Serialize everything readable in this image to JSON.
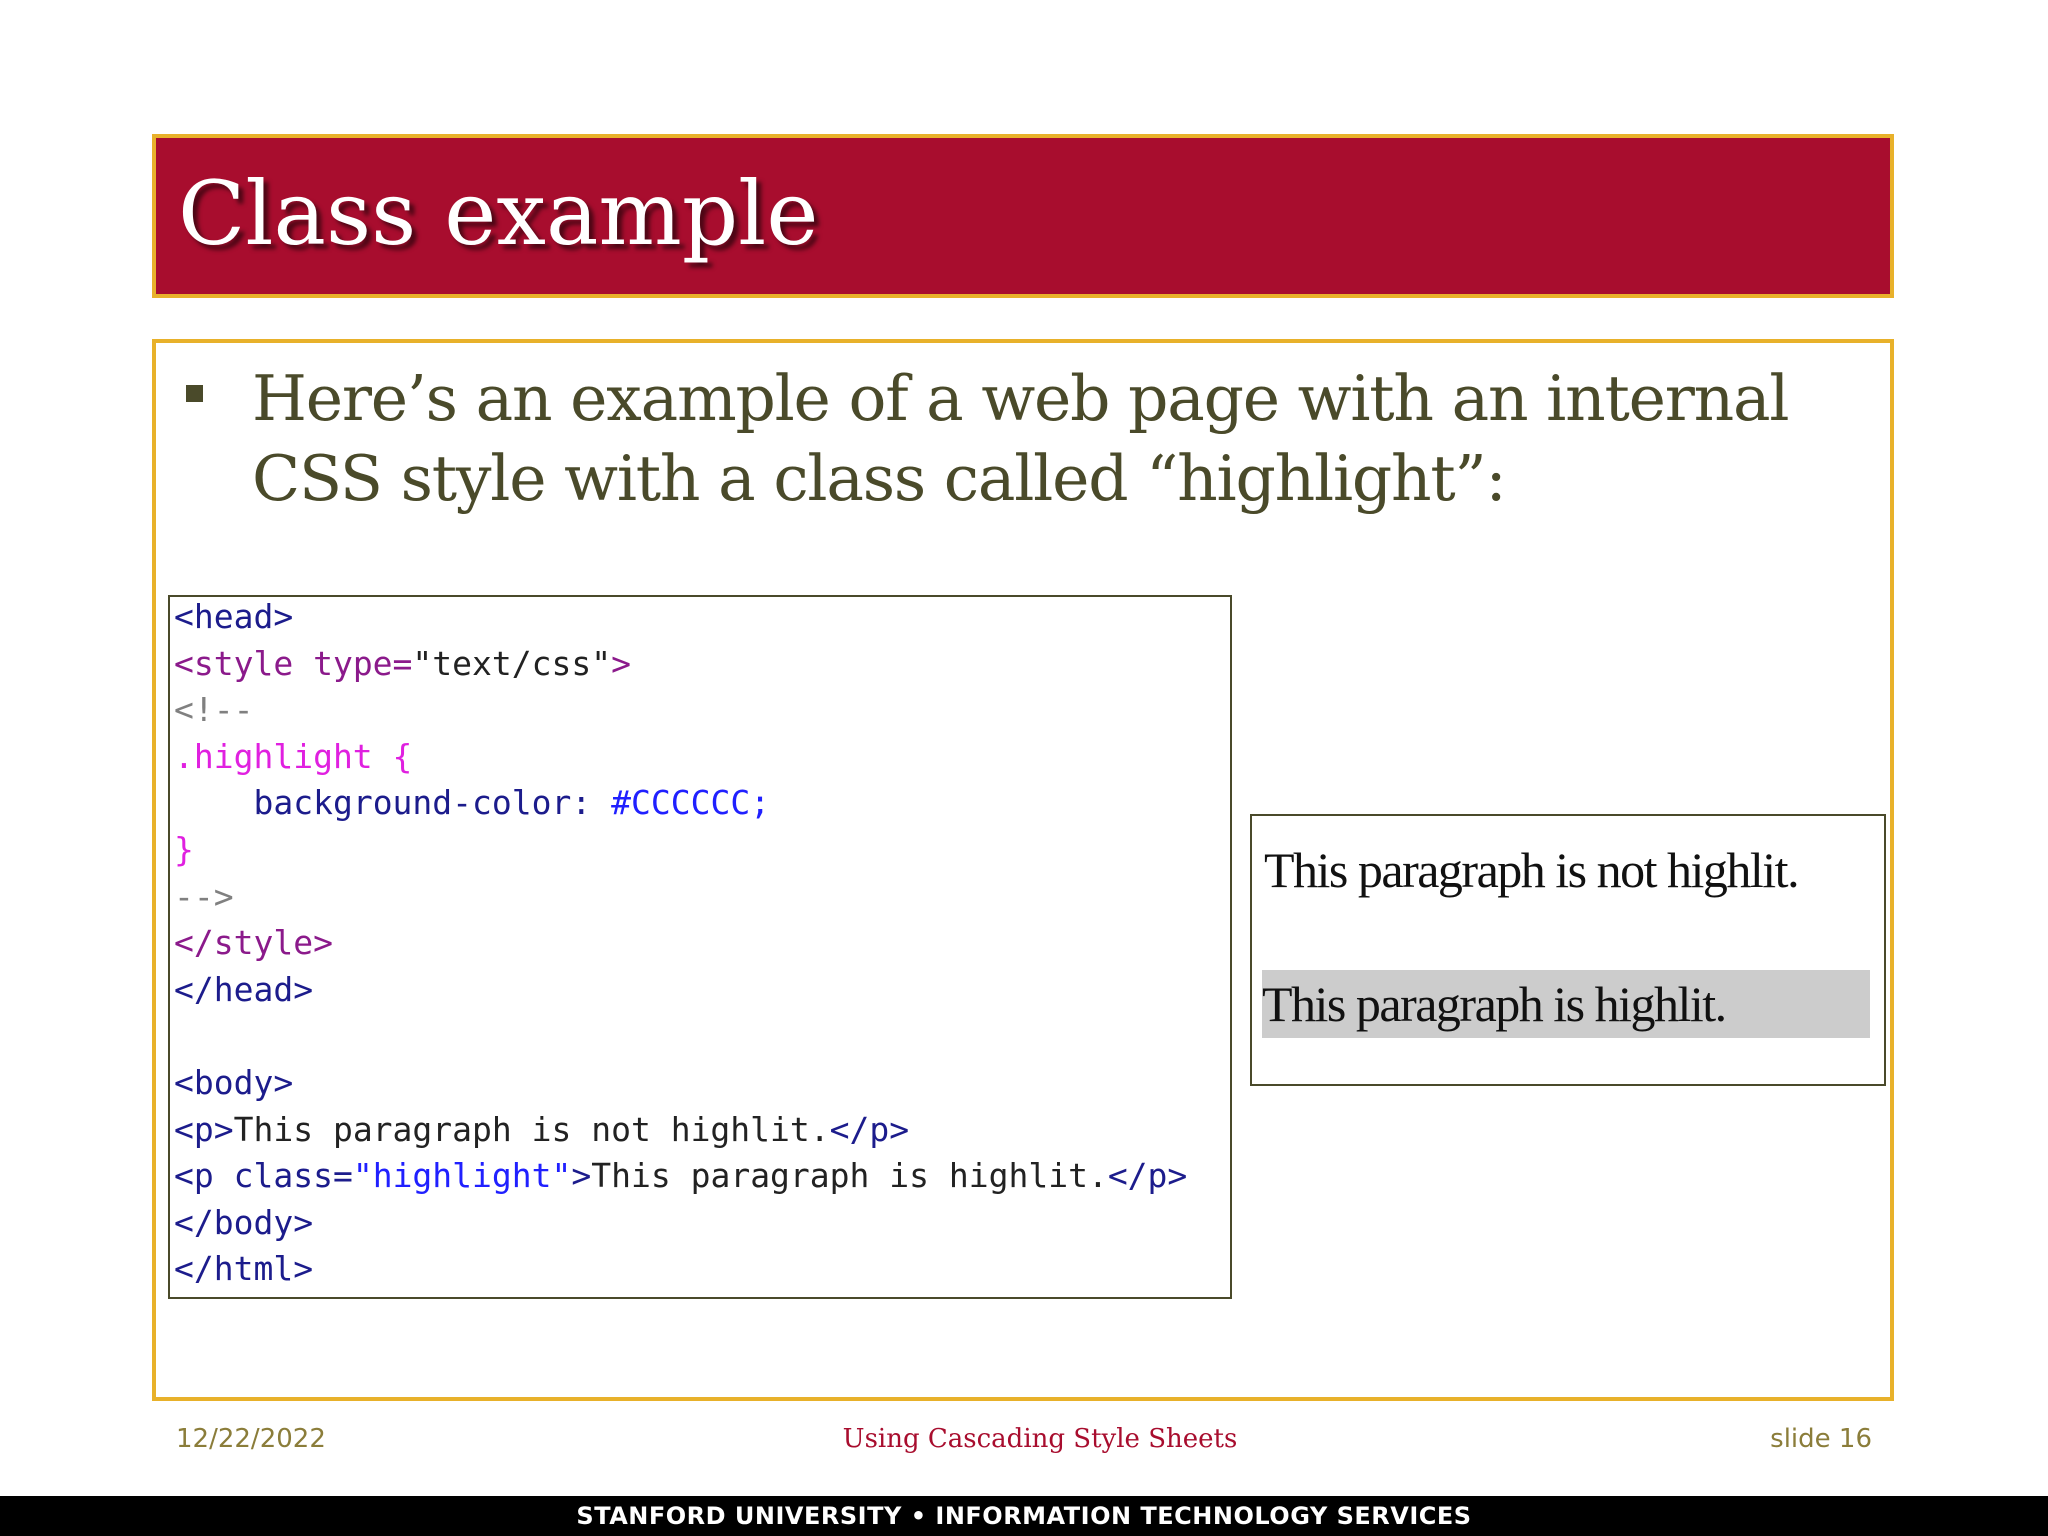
{
  "slide": {
    "title": "Class example",
    "bullet": "Here’s an example of a web page with an internal CSS style with a class called “highlight”:"
  },
  "code": {
    "line1": "<head>",
    "line2_tag": "<style ",
    "line2_attr": "type=",
    "line2_str": "\"text/css\"",
    "line2_close": ">",
    "line3": "<!--",
    "line4": ".highlight {",
    "line5_indent": "    ",
    "line5_prop": "background-color: ",
    "line5_val": "#CCCCCC;",
    "line6": "}",
    "line7": "-->",
    "line8": "</style>",
    "line9": "</head>",
    "line10": "",
    "line11": "<body>",
    "line12_open": "<p>",
    "line12_text": "This paragraph is not highlit.",
    "line12_close": "</p>",
    "line13_open": "<p ",
    "line13_attr": "class=",
    "line13_str": "\"highlight\"",
    "line13_gt": ">",
    "line13_text": "This paragraph is highlit.",
    "line13_close": "</p>",
    "line14": "</body>",
    "line15": "</html>"
  },
  "preview": {
    "paragraph1": "This paragraph is not highlit.",
    "paragraph2": "This paragraph is highlit.",
    "highlight_color": "#CCCCCC"
  },
  "footer": {
    "date": "12/22/2022",
    "title": "Using Cascading Style Sheets",
    "slide_number": "slide 16",
    "organization": "STANFORD UNIVERSITY • INFORMATION TECHNOLOGY SERVICES"
  },
  "colors": {
    "title_bar": "#a80d2e",
    "border": "#e8b12a",
    "body_text": "#4a4a2a"
  }
}
